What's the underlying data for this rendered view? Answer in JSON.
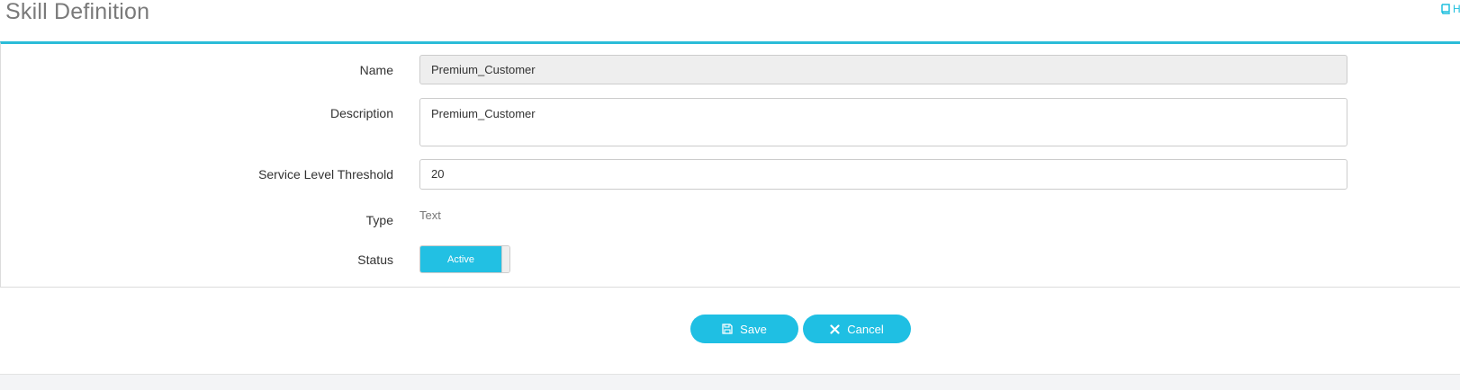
{
  "header": {
    "title": "Skill Definition",
    "help_label": "H"
  },
  "form": {
    "name": {
      "label": "Name",
      "value": "Premium_Customer"
    },
    "description": {
      "label": "Description",
      "value": "Premium_Customer"
    },
    "service_level_threshold": {
      "label": "Service Level Threshold",
      "value": "20"
    },
    "type": {
      "label": "Type",
      "value": "Text"
    },
    "status": {
      "label": "Status",
      "toggle_label": "Active",
      "on": true
    }
  },
  "actions": {
    "save_label": "Save",
    "cancel_label": "Cancel"
  },
  "colors": {
    "accent": "#22c0e3",
    "panel_border": "#2bbcd8",
    "readonly_bg": "#eeeeee"
  }
}
